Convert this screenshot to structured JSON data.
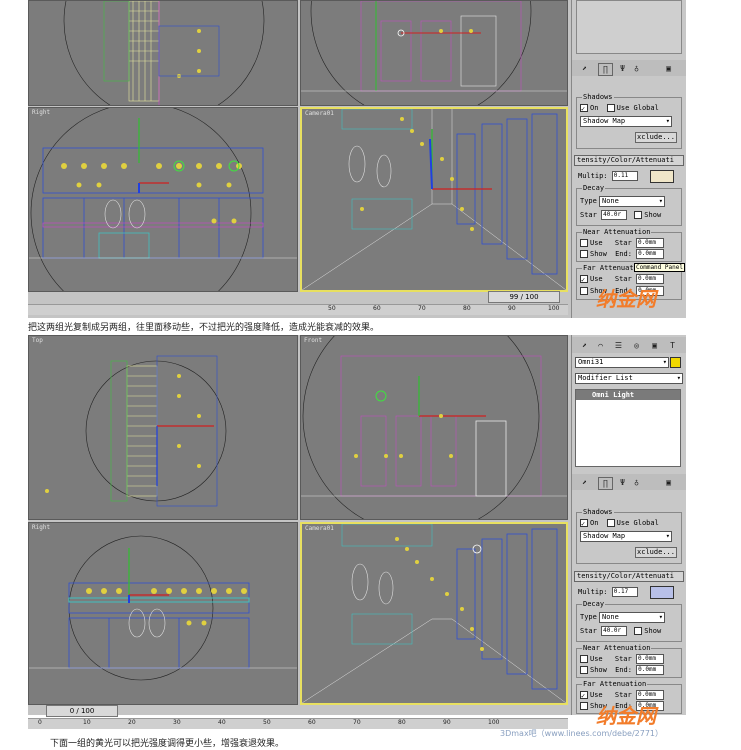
{
  "screenshot1": {
    "viewports": {
      "right": "Right",
      "camera": "Camera01"
    },
    "panel": {
      "shadows_title": "Shadows",
      "on_label": "On",
      "use_global_label": "Use Global",
      "shadow_type": "Shadow Map",
      "exclude_label": "xclude...",
      "intensity_header": "tensity/Color/Attenuati",
      "multiplier_label": "Multip:",
      "multiplier_value": "0.11",
      "swatch_color": "#f0e6c8",
      "decay_title": "Decay",
      "type_label": "Type",
      "type_value": "None",
      "start_label": "Star",
      "start_value": "40.0r",
      "show_label": "Show",
      "near_title": "Near Attenuation",
      "use_label": "Use",
      "start_short": "Star",
      "end_label": "End:",
      "near_start": "0.0mm",
      "near_end": "0.0mm",
      "far_title": "Far Attenuati",
      "far_start": "0.0mm",
      "far_end": "0.0mm",
      "tooltip": "Command Panel"
    },
    "timeline": "99 / 100",
    "ruler_ticks": [
      "50",
      "60",
      "70",
      "80",
      "90",
      "100"
    ]
  },
  "caption1": "把这两组光复制成另两组，往里面移动些，不过把光的强度降低，造成光能衰减的效果。",
  "screenshot2": {
    "viewports": {
      "top": "Top",
      "front": "Front",
      "right": "Right",
      "camera": "Camera01"
    },
    "panel": {
      "object_name": "Omni31",
      "name_swatch": "#f0d800",
      "modifier_list": "Modifier List",
      "stack_item": "Omni Light",
      "shadows_title": "Shadows",
      "on_label": "On",
      "use_global_label": "Use Global",
      "shadow_type": "Shadow Map",
      "exclude_label": "xclude...",
      "intensity_header": "tensity/Color/Attenuati",
      "multiplier_label": "Multip:",
      "multiplier_value": "0.17",
      "swatch_color": "#b8c0e8",
      "decay_title": "Decay",
      "type_label": "Type",
      "type_value": "None",
      "start_label": "Star",
      "start_value": "40.0r",
      "show_label": "Show",
      "near_title": "Near Attenuation",
      "use_label": "Use",
      "start_short": "Star",
      "end_label": "End:",
      "near_start": "0.0mm",
      "near_end": "0.0mm",
      "far_title": "Far Attenuation",
      "far_start": "0.0mm",
      "far_end": "0.0mm"
    },
    "timeline": "0 / 100",
    "ruler_ticks": [
      "0",
      "10",
      "20",
      "30",
      "40",
      "50",
      "60",
      "70",
      "80",
      "90",
      "100"
    ]
  },
  "caption2": "下面一组的黄光可以把光强度调得更小些，增强衰退效果。",
  "watermark": "纳金网",
  "credit": "3Dmax吧（www.linees.com/debe/2771）"
}
